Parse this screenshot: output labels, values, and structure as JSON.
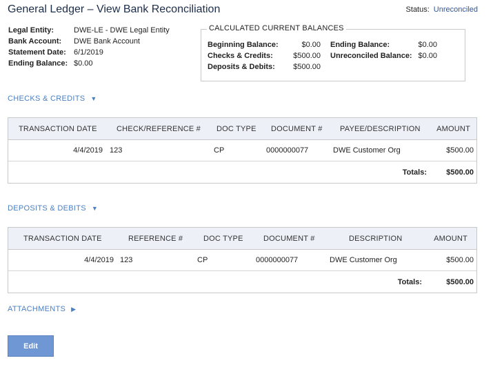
{
  "page": {
    "title": "General Ledger – View Bank Reconciliation",
    "status_label": "Status:",
    "status_value": "Unreconciled"
  },
  "info": {
    "legal_entity_label": "Legal Entity:",
    "legal_entity_value": "DWE-LE - DWE Legal Entity",
    "bank_account_label": "Bank Account:",
    "bank_account_value": "DWE Bank Account",
    "statement_date_label": "Statement Date:",
    "statement_date_value": "6/1/2019",
    "ending_balance_label": "Ending Balance:",
    "ending_balance_value": "$0.00"
  },
  "balances": {
    "legend": "CALCULATED CURRENT BALANCES",
    "beginning_label": "Beginning Balance:",
    "beginning_value": "$0.00",
    "checks_credits_label": "Checks & Credits:",
    "checks_credits_value": "$500.00",
    "deposits_debits_label": "Deposits & Debits:",
    "deposits_debits_value": "$500.00",
    "ending_label": "Ending Balance:",
    "ending_value": "$0.00",
    "unreconciled_label": "Unreconciled Balance:",
    "unreconciled_value": "$0.00"
  },
  "checks": {
    "section_label": "CHECKS & CREDITS",
    "headers": [
      "TRANSACTION DATE",
      "CHECK/REFERENCE #",
      "DOC TYPE",
      "DOCUMENT #",
      "PAYEE/DESCRIPTION",
      "AMOUNT"
    ],
    "rows": [
      {
        "date": "4/4/2019",
        "ref": "123",
        "doc_type": "CP",
        "doc_no": "0000000077",
        "payee": "DWE Customer Org",
        "amount": "$500.00"
      }
    ],
    "totals_label": "Totals:",
    "totals_value": "$500.00"
  },
  "deposits": {
    "section_label": "DEPOSITS & DEBITS",
    "headers": [
      "TRANSACTION DATE",
      "REFERENCE #",
      "DOC TYPE",
      "DOCUMENT #",
      "DESCRIPTION",
      "AMOUNT"
    ],
    "rows": [
      {
        "date": "4/4/2019",
        "ref": "123",
        "doc_type": "CP",
        "doc_no": "0000000077",
        "desc": "DWE Customer Org",
        "amount": "$500.00"
      }
    ],
    "totals_label": "Totals:",
    "totals_value": "$500.00"
  },
  "attachments": {
    "section_label": "ATTACHMENTS"
  },
  "actions": {
    "edit_label": "Edit"
  },
  "icons": {
    "caret_down": "caret-down-icon",
    "caret_right": "caret-right-icon"
  },
  "colors": {
    "link": "#4a7fc0",
    "status_value": "#2a55a0",
    "header_bg": "#eef0f8",
    "button_bg": "#6e97d4"
  }
}
